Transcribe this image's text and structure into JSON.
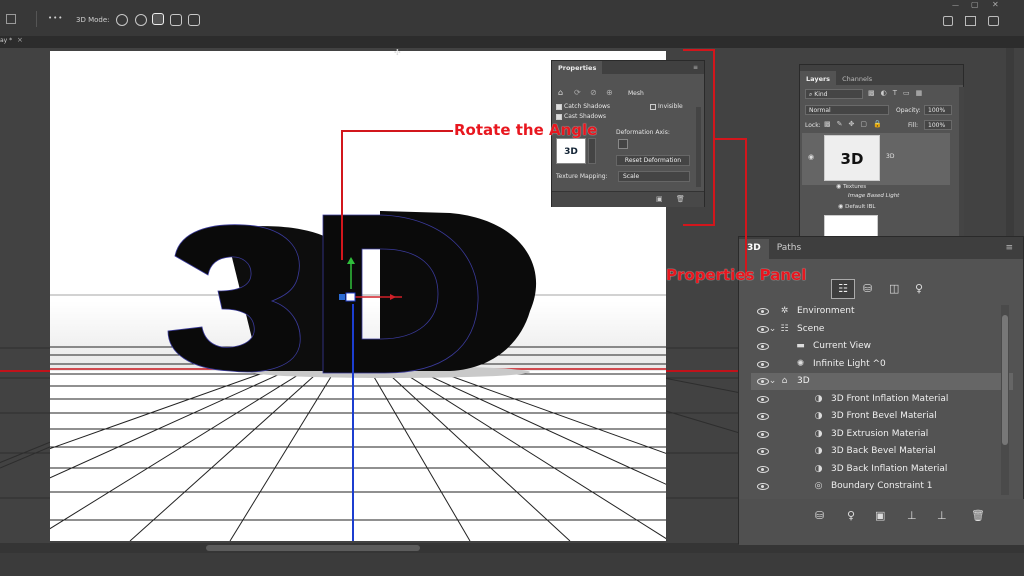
{
  "optionbar": {
    "mode_label": "3D Mode:",
    "dots": "•••"
  },
  "tabbar": {
    "doc_tab": "ay *"
  },
  "properties_panel": {
    "tab": "Properties",
    "mesh_label": "Mesh",
    "catch_shadows": "Catch Shadows",
    "cast_shadows": "Cast Shadows",
    "invisible": "Invisible",
    "deformation_axis": "Deformation Axis:",
    "reset_deformation": "Reset Deformation",
    "texture_mapping_label": "Texture Mapping:",
    "texture_mapping_value": "Scale",
    "thumb_text": "3D"
  },
  "layers_panel": {
    "tabs": [
      "Layers",
      "Channels"
    ],
    "kind": "Kind",
    "blend": "Normal",
    "opacity_label": "Opacity:",
    "opacity_value": "100%",
    "lock_label": "Lock:",
    "fill_label": "Fill:",
    "fill_value": "100%",
    "layer_name": "3D",
    "thumb_text": "3D",
    "sub_items": [
      "Textures",
      "Image Based Light",
      "Default IBL"
    ]
  },
  "panel_3d": {
    "tabs": [
      "3D",
      "Paths"
    ],
    "rows": [
      {
        "label": "Environment",
        "icon": "environment-icon"
      },
      {
        "label": "Scene",
        "icon": "scene-icon"
      },
      {
        "label": "Current View",
        "icon": "camera-icon"
      },
      {
        "label": "Infinite Light ^0",
        "icon": "light-icon"
      },
      {
        "label": "3D",
        "icon": "mesh-icon"
      },
      {
        "label": "3D Front Inflation Material",
        "icon": "material-icon"
      },
      {
        "label": "3D Front Bevel Material",
        "icon": "material-icon"
      },
      {
        "label": "3D Extrusion Material",
        "icon": "material-icon"
      },
      {
        "label": "3D Back Bevel Material",
        "icon": "material-icon"
      },
      {
        "label": "3D Back Inflation Material",
        "icon": "material-icon"
      },
      {
        "label": "Boundary Constraint 1",
        "icon": "constraint-icon"
      }
    ]
  },
  "annotations": {
    "rotate": "Rotate the Angle",
    "properties": "Properties Panel"
  },
  "canvas": {
    "text3d": "3D"
  },
  "colors": {
    "annotation": "#e8171f",
    "panel_bg": "#535353",
    "workspace": "#424242",
    "selected_row": "#666666"
  }
}
